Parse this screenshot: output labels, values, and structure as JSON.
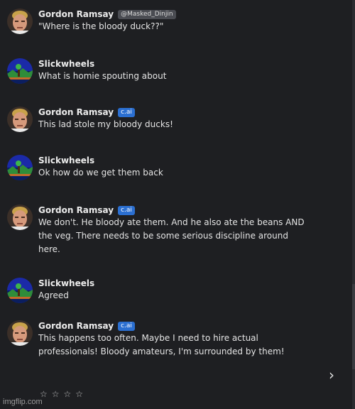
{
  "messages": [
    {
      "author": "Gordon Ramsay",
      "tag": "@Masked_Dinjin",
      "tag_type": "handle",
      "avatar": "gordon",
      "text": "\"Where is the bloody duck??\""
    },
    {
      "author": "Slickwheels",
      "tag": "",
      "tag_type": "",
      "avatar": "slick",
      "text": "What is homie spouting about"
    },
    {
      "author": "Gordon Ramsay",
      "tag": "c.ai",
      "tag_type": "cai",
      "avatar": "gordon",
      "text": "This lad stole my bloody ducks!"
    },
    {
      "author": "Slickwheels",
      "tag": "",
      "tag_type": "",
      "avatar": "slick",
      "text": "Ok how do we get them back"
    },
    {
      "author": "Gordon Ramsay",
      "tag": "c.ai",
      "tag_type": "cai",
      "avatar": "gordon",
      "text": "We don't. He bloody ate them. And he also ate the beans AND the veg. There needs to be some serious discipline around here."
    },
    {
      "author": "Slickwheels",
      "tag": "",
      "tag_type": "",
      "avatar": "slick",
      "text": "Agreed"
    },
    {
      "author": "Gordon Ramsay",
      "tag": "c.ai",
      "tag_type": "cai",
      "avatar": "gordon",
      "text": "This happens too often. Maybe I need to hire actual professionals! Bloody amateurs, I'm surrounded by them!"
    }
  ],
  "controls": {
    "next_icon": "chevron-right-icon",
    "next_symbol": "›"
  },
  "rating": {
    "stars": [
      "☆",
      "☆",
      "☆",
      "☆"
    ],
    "value": 0,
    "max": 4
  },
  "watermark": "imgflip.com",
  "colors": {
    "cai_badge": "#2b6fd1",
    "handle_badge": "#4a4c52",
    "background": "#1e1f22"
  }
}
